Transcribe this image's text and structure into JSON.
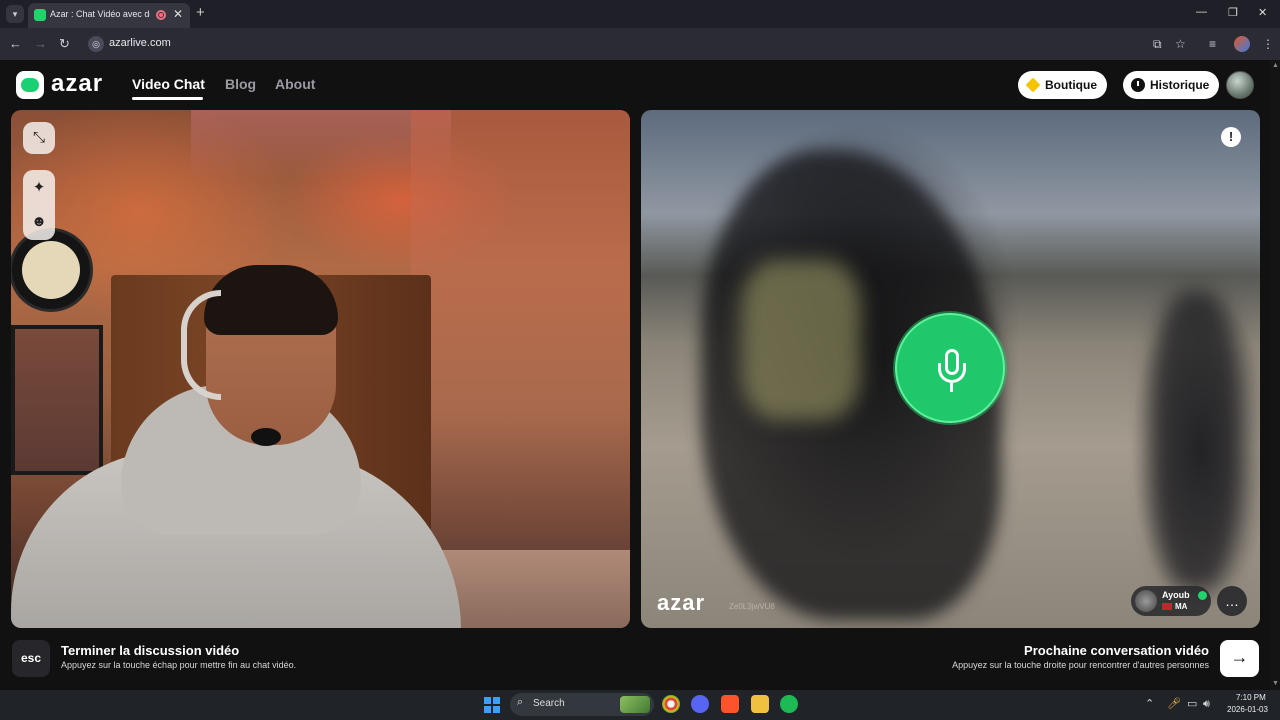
{
  "browser": {
    "tab_title": "Azar : Chat Vidéo avec de n",
    "new_tab": "+",
    "tab_close": "✕",
    "url": "azarlive.com",
    "window": {
      "minimize": "—",
      "restore": "❐",
      "close": "✕"
    }
  },
  "site": {
    "logo": "azar",
    "nav": {
      "video_chat": "Video Chat",
      "blog": "Blog",
      "about": "About"
    },
    "boutique_label": "Boutique",
    "historique_label": "Historique"
  },
  "remote": {
    "watermark": "azar",
    "session_id": "Ze0L3jwVU8",
    "partner": {
      "name": "Ayoub",
      "country": "MA"
    }
  },
  "hints": {
    "esc_key": "esc",
    "end_title": "Terminer la discussion vidéo",
    "end_sub": "Appuyez sur la touche échap pour mettre fin au chat vidéo.",
    "next_title": "Prochaine conversation vidéo",
    "next_sub": "Appuyez sur la touche droite pour rencontrer d'autres personnes",
    "next_arrow": "→"
  },
  "taskbar": {
    "search_label": "Search",
    "time": "7:10 PM",
    "date": "2026-01-03"
  },
  "icons": {
    "brand_green": "#1fc86a",
    "boutique_icon": "diamond-icon",
    "historique_icon": "clock-icon",
    "mic_state": "microphone-icon"
  }
}
